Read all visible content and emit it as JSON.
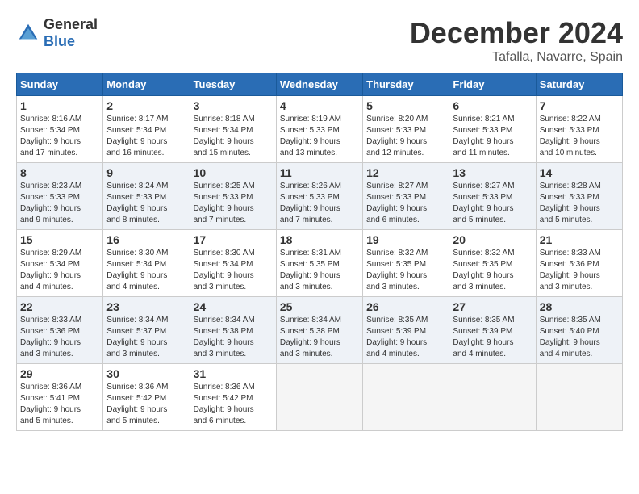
{
  "logo": {
    "general": "General",
    "blue": "Blue"
  },
  "title": "December 2024",
  "location": "Tafalla, Navarre, Spain",
  "days_of_week": [
    "Sunday",
    "Monday",
    "Tuesday",
    "Wednesday",
    "Thursday",
    "Friday",
    "Saturday"
  ],
  "weeks": [
    [
      {
        "day": "1",
        "sunrise": "8:16 AM",
        "sunset": "5:34 PM",
        "daylight": "9 hours and 17 minutes."
      },
      {
        "day": "2",
        "sunrise": "8:17 AM",
        "sunset": "5:34 PM",
        "daylight": "9 hours and 16 minutes."
      },
      {
        "day": "3",
        "sunrise": "8:18 AM",
        "sunset": "5:34 PM",
        "daylight": "9 hours and 15 minutes."
      },
      {
        "day": "4",
        "sunrise": "8:19 AM",
        "sunset": "5:33 PM",
        "daylight": "9 hours and 13 minutes."
      },
      {
        "day": "5",
        "sunrise": "8:20 AM",
        "sunset": "5:33 PM",
        "daylight": "9 hours and 12 minutes."
      },
      {
        "day": "6",
        "sunrise": "8:21 AM",
        "sunset": "5:33 PM",
        "daylight": "9 hours and 11 minutes."
      },
      {
        "day": "7",
        "sunrise": "8:22 AM",
        "sunset": "5:33 PM",
        "daylight": "9 hours and 10 minutes."
      }
    ],
    [
      {
        "day": "8",
        "sunrise": "8:23 AM",
        "sunset": "5:33 PM",
        "daylight": "9 hours and 9 minutes."
      },
      {
        "day": "9",
        "sunrise": "8:24 AM",
        "sunset": "5:33 PM",
        "daylight": "9 hours and 8 minutes."
      },
      {
        "day": "10",
        "sunrise": "8:25 AM",
        "sunset": "5:33 PM",
        "daylight": "9 hours and 7 minutes."
      },
      {
        "day": "11",
        "sunrise": "8:26 AM",
        "sunset": "5:33 PM",
        "daylight": "9 hours and 7 minutes."
      },
      {
        "day": "12",
        "sunrise": "8:27 AM",
        "sunset": "5:33 PM",
        "daylight": "9 hours and 6 minutes."
      },
      {
        "day": "13",
        "sunrise": "8:27 AM",
        "sunset": "5:33 PM",
        "daylight": "9 hours and 5 minutes."
      },
      {
        "day": "14",
        "sunrise": "8:28 AM",
        "sunset": "5:33 PM",
        "daylight": "9 hours and 5 minutes."
      }
    ],
    [
      {
        "day": "15",
        "sunrise": "8:29 AM",
        "sunset": "5:34 PM",
        "daylight": "9 hours and 4 minutes."
      },
      {
        "day": "16",
        "sunrise": "8:30 AM",
        "sunset": "5:34 PM",
        "daylight": "9 hours and 4 minutes."
      },
      {
        "day": "17",
        "sunrise": "8:30 AM",
        "sunset": "5:34 PM",
        "daylight": "9 hours and 3 minutes."
      },
      {
        "day": "18",
        "sunrise": "8:31 AM",
        "sunset": "5:35 PM",
        "daylight": "9 hours and 3 minutes."
      },
      {
        "day": "19",
        "sunrise": "8:32 AM",
        "sunset": "5:35 PM",
        "daylight": "9 hours and 3 minutes."
      },
      {
        "day": "20",
        "sunrise": "8:32 AM",
        "sunset": "5:35 PM",
        "daylight": "9 hours and 3 minutes."
      },
      {
        "day": "21",
        "sunrise": "8:33 AM",
        "sunset": "5:36 PM",
        "daylight": "9 hours and 3 minutes."
      }
    ],
    [
      {
        "day": "22",
        "sunrise": "8:33 AM",
        "sunset": "5:36 PM",
        "daylight": "9 hours and 3 minutes."
      },
      {
        "day": "23",
        "sunrise": "8:34 AM",
        "sunset": "5:37 PM",
        "daylight": "9 hours and 3 minutes."
      },
      {
        "day": "24",
        "sunrise": "8:34 AM",
        "sunset": "5:38 PM",
        "daylight": "9 hours and 3 minutes."
      },
      {
        "day": "25",
        "sunrise": "8:34 AM",
        "sunset": "5:38 PM",
        "daylight": "9 hours and 3 minutes."
      },
      {
        "day": "26",
        "sunrise": "8:35 AM",
        "sunset": "5:39 PM",
        "daylight": "9 hours and 4 minutes."
      },
      {
        "day": "27",
        "sunrise": "8:35 AM",
        "sunset": "5:39 PM",
        "daylight": "9 hours and 4 minutes."
      },
      {
        "day": "28",
        "sunrise": "8:35 AM",
        "sunset": "5:40 PM",
        "daylight": "9 hours and 4 minutes."
      }
    ],
    [
      {
        "day": "29",
        "sunrise": "8:36 AM",
        "sunset": "5:41 PM",
        "daylight": "9 hours and 5 minutes."
      },
      {
        "day": "30",
        "sunrise": "8:36 AM",
        "sunset": "5:42 PM",
        "daylight": "9 hours and 5 minutes."
      },
      {
        "day": "31",
        "sunrise": "8:36 AM",
        "sunset": "5:42 PM",
        "daylight": "9 hours and 6 minutes."
      },
      null,
      null,
      null,
      null
    ]
  ],
  "labels": {
    "sunrise": "Sunrise:",
    "sunset": "Sunset:",
    "daylight": "Daylight hours"
  }
}
